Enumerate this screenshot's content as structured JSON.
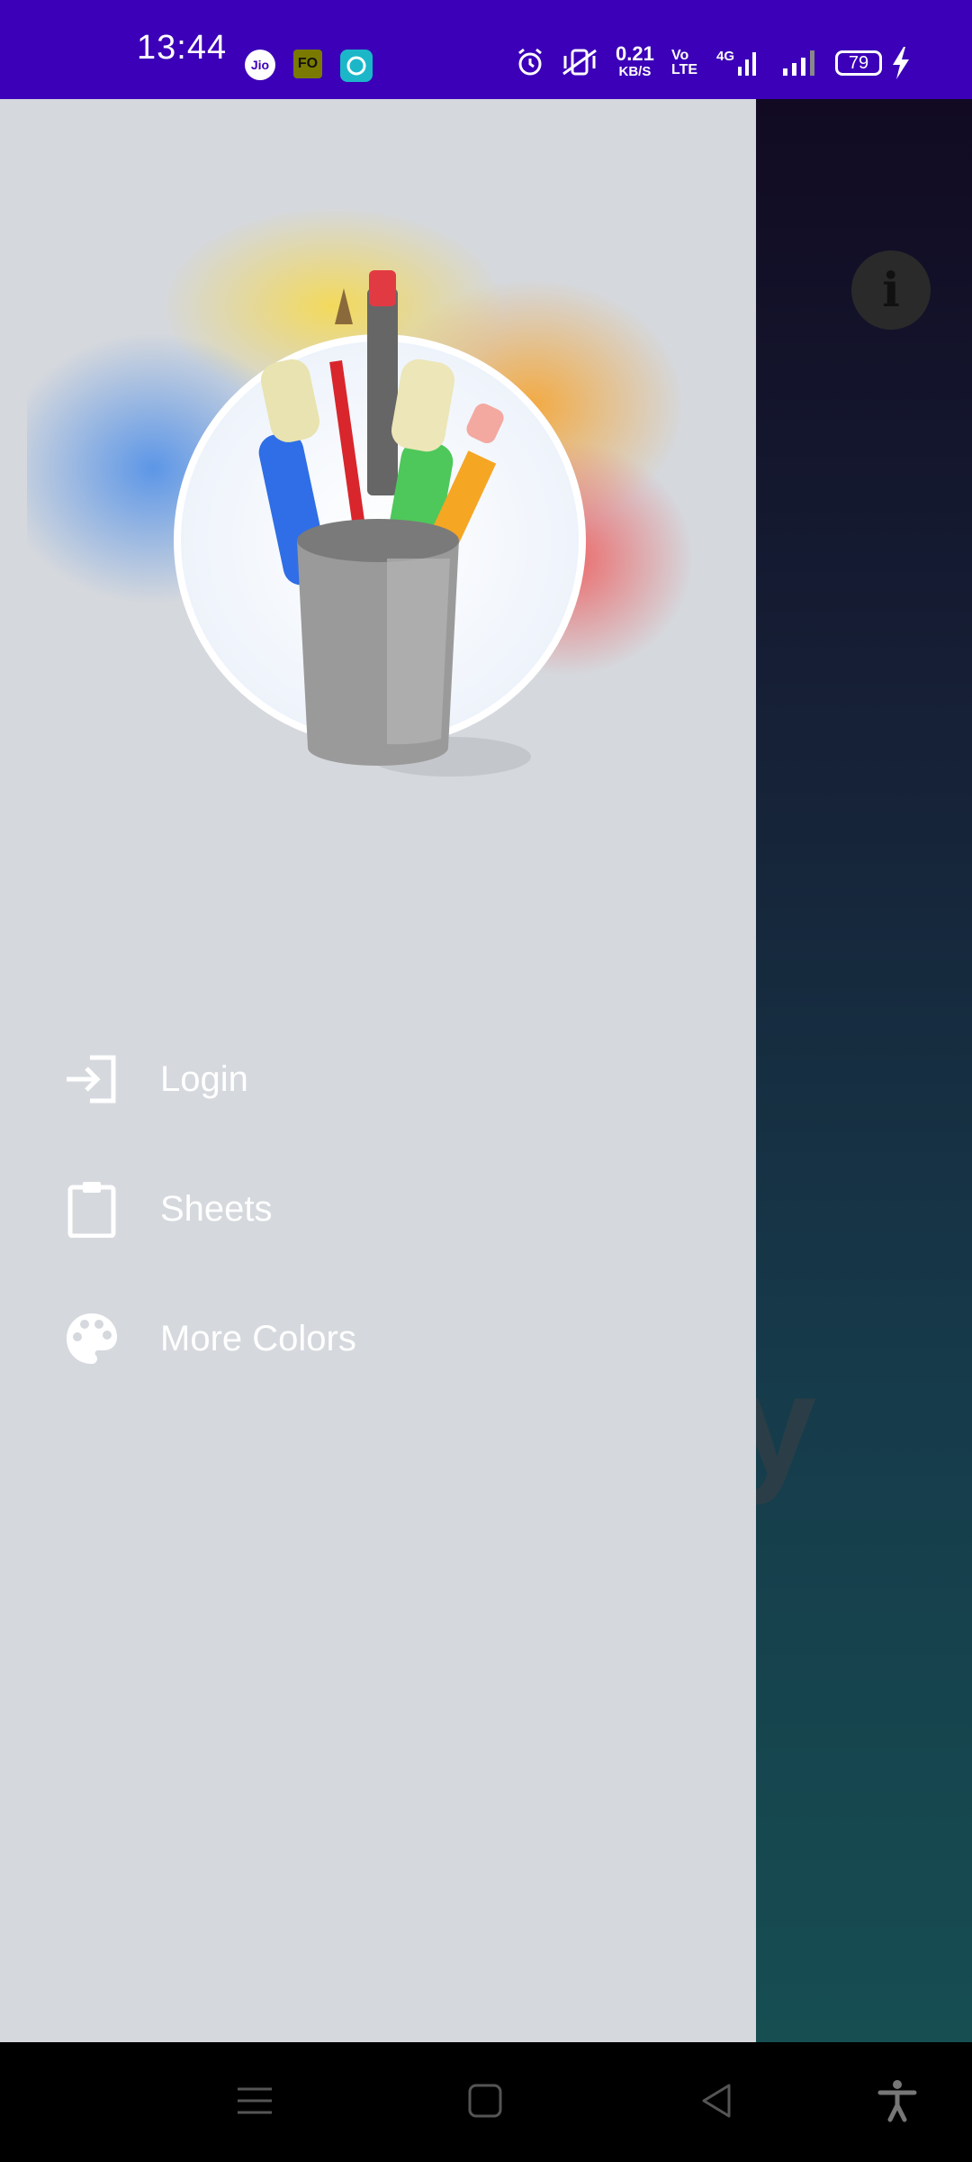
{
  "status_bar": {
    "time": "13:44",
    "app_icons": [
      "jio-icon",
      "fo-icon",
      "chat-icon"
    ],
    "jio_label": "Jio",
    "fo_label": "FO",
    "speed_value": "0.21",
    "speed_unit": "KB/S",
    "volte_line1": "Vo",
    "volte_line2": "LTE",
    "network": "4G",
    "battery": "79"
  },
  "drawer": {
    "menu": [
      {
        "label": "Login",
        "icon": "login-icon"
      },
      {
        "label": "Sheets",
        "icon": "clipboard-icon"
      },
      {
        "label": "More Colors",
        "icon": "palette-icon"
      }
    ]
  },
  "background_app": {
    "partial_text": "y"
  },
  "colors": {
    "status_bar": "#3b00b8",
    "drawer_bg": "#d5d8dd",
    "menu_text": "#ffffff"
  }
}
